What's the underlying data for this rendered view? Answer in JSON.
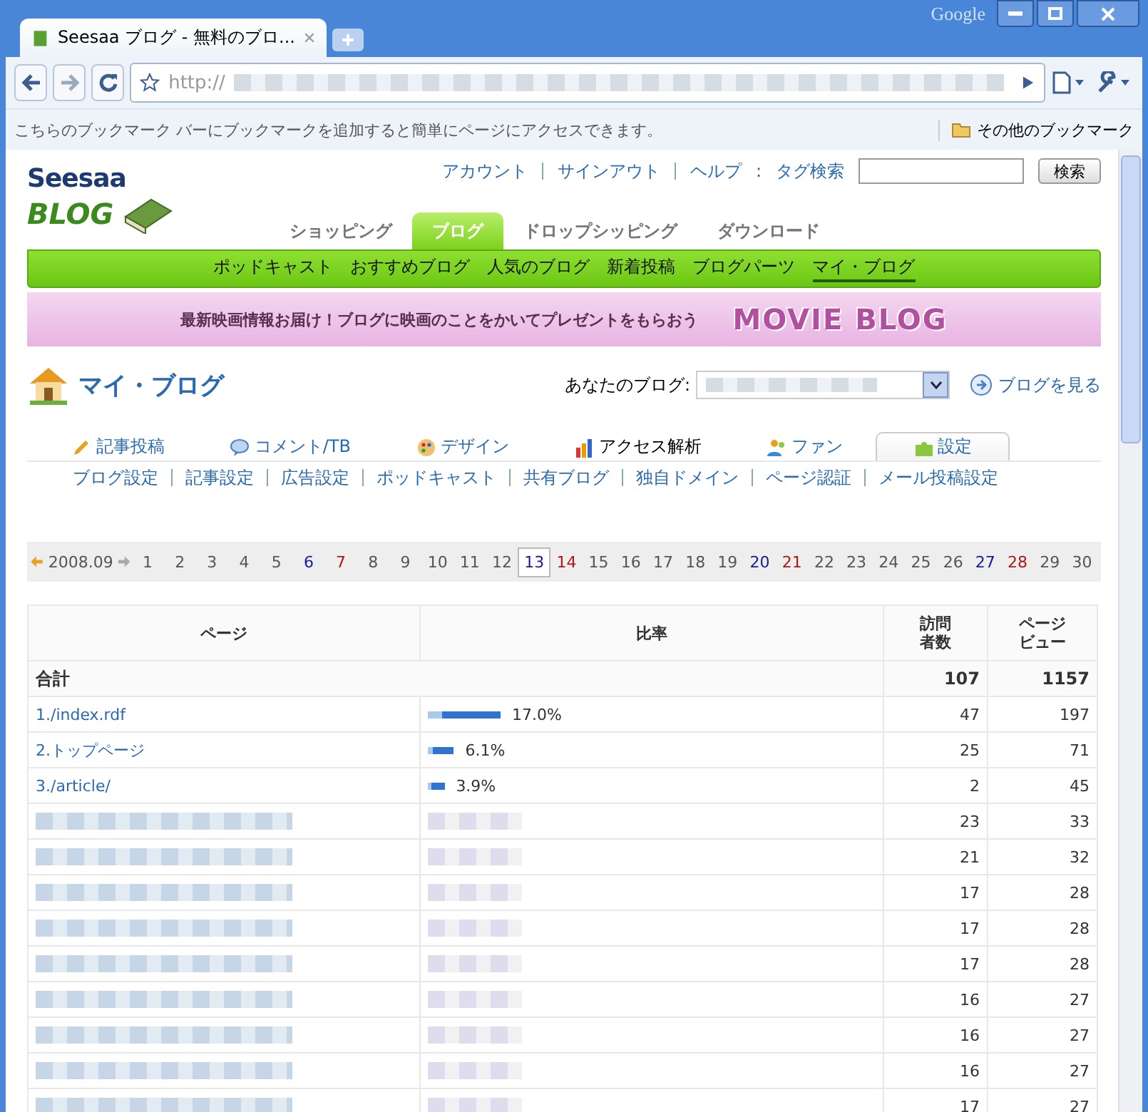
{
  "browser": {
    "google_label": "Google",
    "tab_title": "Seesaa ブログ - 無料のブロ...",
    "url": "http://",
    "bookmarks_message": "こちらのブックマーク バーにブックマークを追加すると簡単にページにアクセスできます。",
    "other_bookmarks": "その他のブックマーク"
  },
  "header": {
    "logo_top": "Seesaa",
    "logo_bottom": "BLOG",
    "top_links": [
      "アカウント",
      "サインアウト",
      "ヘルプ"
    ],
    "search_separator": ":",
    "search_label": "タグ検索",
    "search_button": "検索"
  },
  "main_tabs": [
    {
      "label": "ショッピング",
      "selected": false
    },
    {
      "label": "ブログ",
      "selected": true
    },
    {
      "label": "ドロップシッピング",
      "selected": false
    },
    {
      "label": "ダウンロード",
      "selected": false
    }
  ],
  "subnav": [
    {
      "label": "ポッドキャスト",
      "selected": false
    },
    {
      "label": "おすすめブログ",
      "selected": false
    },
    {
      "label": "人気のブログ",
      "selected": false
    },
    {
      "label": "新着投稿",
      "selected": false
    },
    {
      "label": "ブログパーツ",
      "selected": false
    },
    {
      "label": "マイ・ブログ",
      "selected": true
    }
  ],
  "banner": {
    "text": "最新映画情報お届け！ブログに映画のことをかいてプレゼントをもらおう",
    "logo": "MOVIE BLOG"
  },
  "page": {
    "title": "マイ・ブログ",
    "blog_label": "あなたのブログ:",
    "view_blog": "ブログを見る"
  },
  "section_tabs": [
    {
      "label": "記事投稿",
      "kind": "pencil",
      "active": false,
      "selected": false
    },
    {
      "label": "コメント/TB",
      "kind": "comment",
      "active": false,
      "selected": false
    },
    {
      "label": "デザイン",
      "kind": "palette",
      "active": false,
      "selected": false
    },
    {
      "label": "アクセス解析",
      "kind": "chart",
      "active": true,
      "selected": false
    },
    {
      "label": "ファン",
      "kind": "people",
      "active": false,
      "selected": false
    },
    {
      "label": "設定",
      "kind": "puzzle",
      "active": false,
      "selected": true
    }
  ],
  "settings_links": [
    "ブログ設定",
    "記事設定",
    "広告設定",
    "ポッドキャスト",
    "共有ブログ",
    "独自ドメイン",
    "ページ認証",
    "メール投稿設定"
  ],
  "calendar": {
    "month": "2008.09",
    "days": [
      {
        "label": "1",
        "kind": "weekday",
        "selected": false
      },
      {
        "label": "2",
        "kind": "weekday",
        "selected": false
      },
      {
        "label": "3",
        "kind": "weekday",
        "selected": false
      },
      {
        "label": "4",
        "kind": "weekday",
        "selected": false
      },
      {
        "label": "5",
        "kind": "weekday",
        "selected": false
      },
      {
        "label": "6",
        "kind": "saturday",
        "selected": false
      },
      {
        "label": "7",
        "kind": "sunday",
        "selected": false
      },
      {
        "label": "8",
        "kind": "weekday",
        "selected": false
      },
      {
        "label": "9",
        "kind": "weekday",
        "selected": false
      },
      {
        "label": "10",
        "kind": "weekday",
        "selected": false
      },
      {
        "label": "11",
        "kind": "weekday",
        "selected": false
      },
      {
        "label": "12",
        "kind": "weekday",
        "selected": false
      },
      {
        "label": "13",
        "kind": "saturday",
        "selected": true
      },
      {
        "label": "14",
        "kind": "sunday",
        "selected": false
      },
      {
        "label": "15",
        "kind": "weekday",
        "selected": false
      },
      {
        "label": "16",
        "kind": "weekday",
        "selected": false
      },
      {
        "label": "17",
        "kind": "weekday",
        "selected": false
      },
      {
        "label": "18",
        "kind": "weekday",
        "selected": false
      },
      {
        "label": "19",
        "kind": "weekday",
        "selected": false
      },
      {
        "label": "20",
        "kind": "saturday",
        "selected": false
      },
      {
        "label": "21",
        "kind": "sunday",
        "selected": false
      },
      {
        "label": "22",
        "kind": "weekday",
        "selected": false
      },
      {
        "label": "23",
        "kind": "weekday",
        "selected": false
      },
      {
        "label": "24",
        "kind": "weekday",
        "selected": false
      },
      {
        "label": "25",
        "kind": "weekday",
        "selected": false
      },
      {
        "label": "26",
        "kind": "weekday",
        "selected": false
      },
      {
        "label": "27",
        "kind": "saturday",
        "selected": false
      },
      {
        "label": "28",
        "kind": "sunday",
        "selected": false
      },
      {
        "label": "29",
        "kind": "weekday",
        "selected": false
      },
      {
        "label": "30",
        "kind": "weekday",
        "selected": false
      }
    ]
  },
  "table": {
    "columns": [
      [
        "ページ"
      ],
      [
        "比率"
      ],
      [
        "訪問",
        "者数"
      ],
      [
        "ページ",
        "ビュー"
      ]
    ],
    "total": {
      "label": "合計",
      "visitors": "107",
      "views": "1157"
    },
    "rows": [
      {
        "page": "1./index.rdf",
        "level": 0.17,
        "ratio": "17.0%",
        "visitors": "47",
        "views": "197"
      },
      {
        "page": "2.トップページ",
        "level": 0.061,
        "ratio": "6.1%",
        "visitors": "25",
        "views": "71"
      },
      {
        "page": "3./article/",
        "level": 0.039,
        "ratio": "3.9%",
        "visitors": "2",
        "views": "45"
      },
      {
        "visitors": "23",
        "views": "33"
      },
      {
        "visitors": "21",
        "views": "32"
      },
      {
        "visitors": "17",
        "views": "28"
      },
      {
        "visitors": "17",
        "views": "28"
      },
      {
        "visitors": "17",
        "views": "28"
      },
      {
        "visitors": "16",
        "views": "27"
      },
      {
        "visitors": "16",
        "views": "27"
      },
      {
        "visitors": "16",
        "views": "27"
      },
      {
        "visitors": "17",
        "views": "27"
      }
    ]
  }
}
